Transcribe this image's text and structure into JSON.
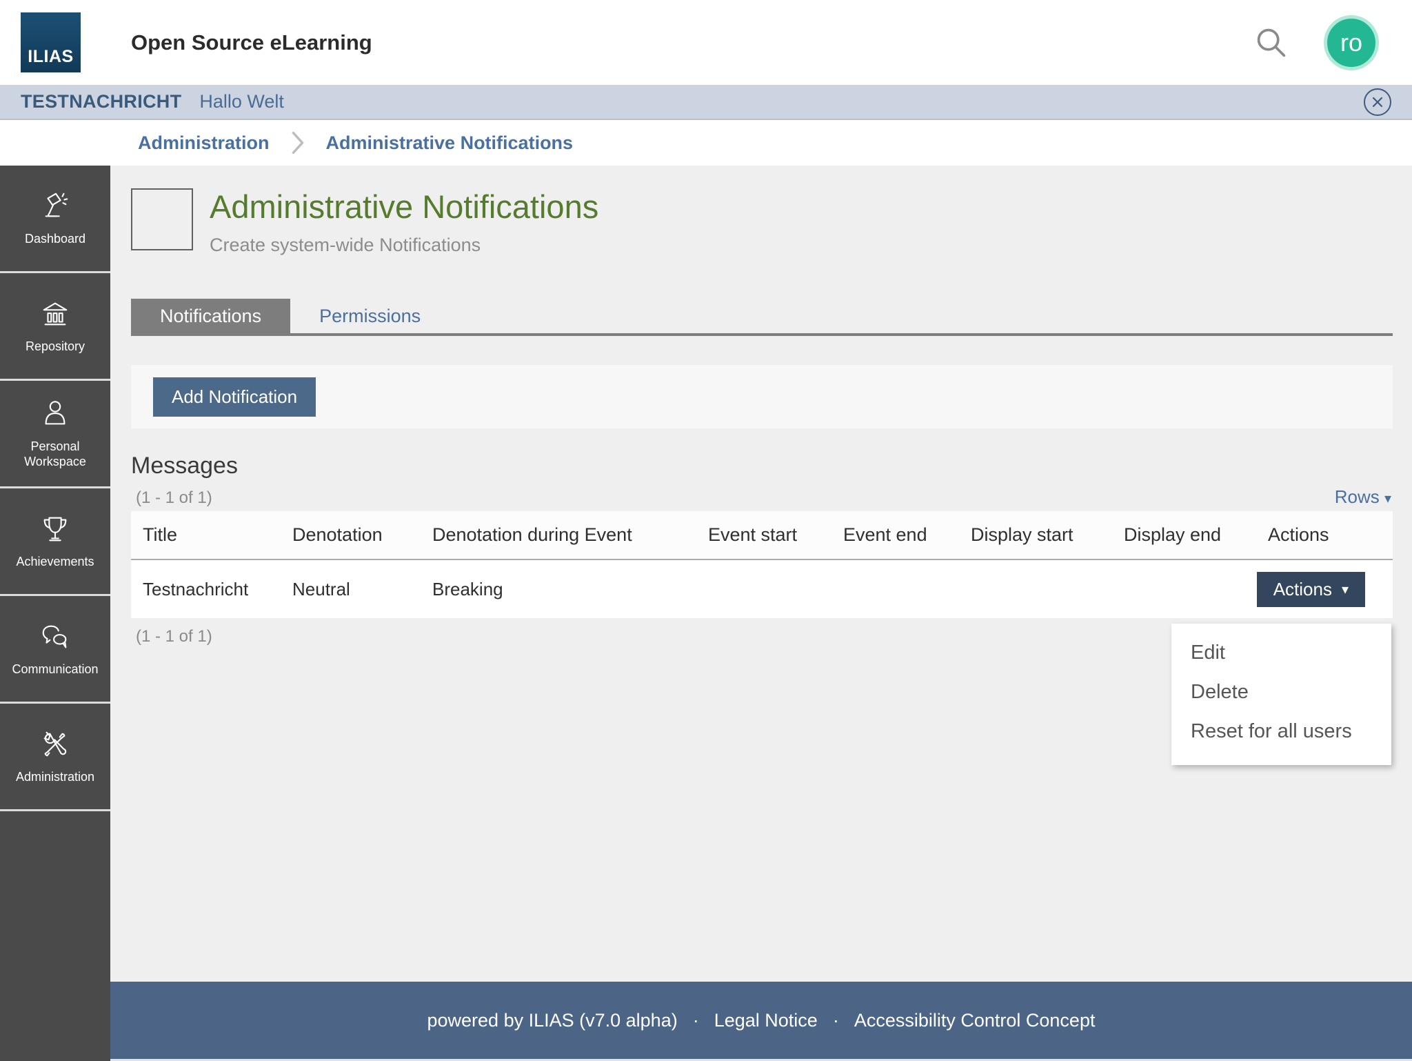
{
  "header": {
    "logo_text": "ILIAS",
    "title": "Open Source eLearning",
    "avatar_label": "ro"
  },
  "notification_bar": {
    "title": "TESTNACHRICHT",
    "message": "Hallo Welt"
  },
  "breadcrumb": {
    "items": [
      "Administration",
      "Administrative Notifications"
    ]
  },
  "sidebar": {
    "items": [
      {
        "label": "Dashboard",
        "icon": "lamp-icon"
      },
      {
        "label": "Repository",
        "icon": "bank-icon"
      },
      {
        "label": "Personal Workspace",
        "icon": "person-icon"
      },
      {
        "label": "Achievements",
        "icon": "trophy-icon"
      },
      {
        "label": "Communication",
        "icon": "chat-icon"
      },
      {
        "label": "Administration",
        "icon": "tools-icon"
      }
    ]
  },
  "page": {
    "title": "Administrative Notifications",
    "subtitle": "Create system-wide Notifications"
  },
  "tabs": [
    {
      "label": "Notifications",
      "active": true
    },
    {
      "label": "Permissions",
      "active": false
    }
  ],
  "toolbar": {
    "add_button": "Add Notification"
  },
  "table": {
    "title": "Messages",
    "range_top": "(1 - 1 of 1)",
    "range_bottom": "(1 - 1 of 1)",
    "rows_label": "Rows",
    "columns": [
      "Title",
      "Denotation",
      "Denotation during Event",
      "Event start",
      "Event end",
      "Display start",
      "Display end",
      "Actions"
    ],
    "rows": [
      {
        "title": "Testnachricht",
        "denotation": "Neutral",
        "denotation_during_event": "Breaking",
        "event_start": "",
        "event_end": "",
        "display_start": "",
        "display_end": "",
        "actions_label": "Actions"
      }
    ]
  },
  "dropdown": {
    "items": [
      "Edit",
      "Delete",
      "Reset for all users"
    ]
  },
  "footer": {
    "powered_by": "powered by ILIAS (v7.0 alpha)",
    "separator": "·",
    "links": [
      "Legal Notice",
      "Accessibility Control Concept"
    ]
  },
  "colors": {
    "brand_navy": "#16486b",
    "link_blue": "#4a70a0",
    "title_green": "#547c2c",
    "primary_button": "#4c6989",
    "actions_button": "#33465e",
    "footer_blue": "#4c6586",
    "sidebar_gray": "#4a4a4a",
    "notification_bg": "#ccd4e2",
    "avatar_teal": "#23b893",
    "active_tab_gray": "#7d7d7d"
  }
}
